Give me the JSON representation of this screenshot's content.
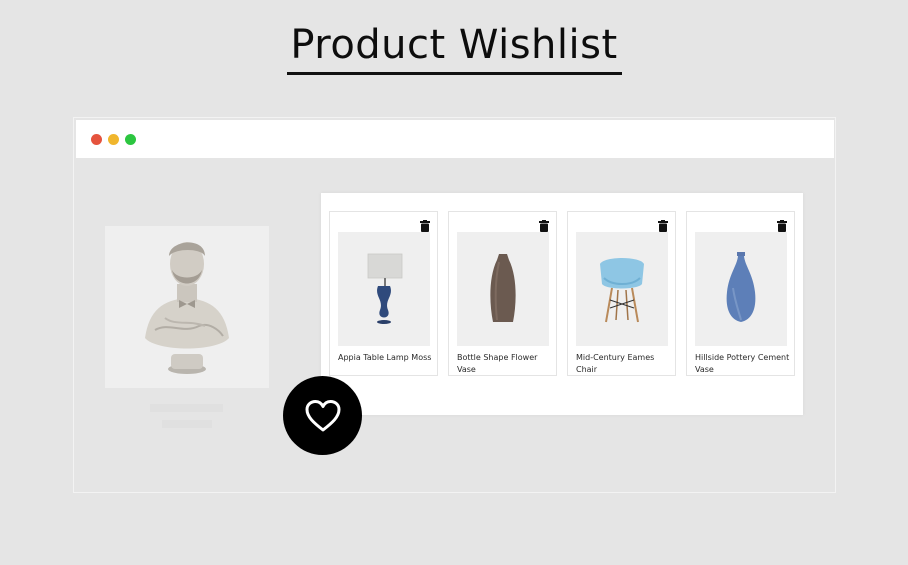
{
  "page": {
    "title": "Product Wishlist"
  },
  "window": {
    "controls": [
      "close",
      "minimize",
      "maximize"
    ],
    "colors": {
      "close": "#e5533d",
      "minimize": "#f0b62d",
      "maximize": "#2cc640"
    }
  },
  "featured_product": {
    "image": "bust-sculpture-image"
  },
  "wishlist": {
    "items": [
      {
        "name": "Appia Table Lamp Moss",
        "image": "table-lamp-image"
      },
      {
        "name": "Bottle Shape Flower Vase",
        "image": "brown-vase-image"
      },
      {
        "name": "Mid-Century Eames Chair",
        "image": "eames-chair-image"
      },
      {
        "name": "Hillside Pottery Cement Vase",
        "image": "blue-vase-image"
      }
    ]
  },
  "icons": {
    "heart": "heart-icon",
    "delete": "trash-icon"
  }
}
